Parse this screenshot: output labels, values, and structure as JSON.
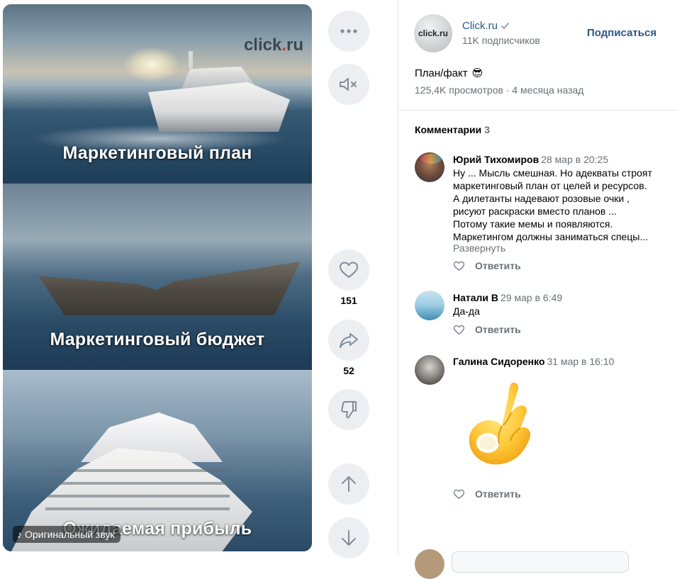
{
  "video": {
    "logo_text": "click",
    "logo_dot": ".",
    "logo_tld": "ru",
    "captions": [
      "Маркетинговый план",
      "Маркетинговый бюджет",
      "Ожидаемая прибыль"
    ],
    "sound_label": "Оригинальный звук"
  },
  "actions": {
    "likes": "151",
    "shares": "52"
  },
  "author": {
    "avatar_text": "click.ru",
    "name": "Click.ru",
    "verified_icon": "check-icon",
    "subscribers": "11K подписчиков",
    "subscribe_label": "Подписаться"
  },
  "post": {
    "title": "План/факт",
    "title_emoji": "😎",
    "meta": "125,4K просмотров · 4 месяца назад"
  },
  "comments_header": {
    "label": "Комментарии",
    "count": "3"
  },
  "comments": [
    {
      "author": "Юрий Тихомиров",
      "date": "28 мар в 20:25",
      "lines": [
        "Ну ... Мысль смешная. Но адекваты строят",
        "маркетинговый план от целей и ресурсов.",
        "А дилетанты надевают розовые очки ,",
        "рисуют раскраски вместо планов ...",
        "Потому такие мемы и появляются.",
        "Маркетингом должны заниматься спецы..."
      ],
      "expand_label": "Развернуть",
      "reply_label": "Ответить"
    },
    {
      "author": "Натали В",
      "date": "29 мар в 6:49",
      "lines": [
        "Да-да"
      ],
      "reply_label": "Ответить"
    },
    {
      "author": "Галина Сидоренко",
      "date": "31 мар в 16:10",
      "sticker": "ok-hand-sticker",
      "reply_label": "Ответить"
    }
  ],
  "colors": {
    "link": "#2a5885",
    "muted": "#6b7075",
    "button_bg": "#eceef1",
    "divider": "#e1e3e6"
  }
}
